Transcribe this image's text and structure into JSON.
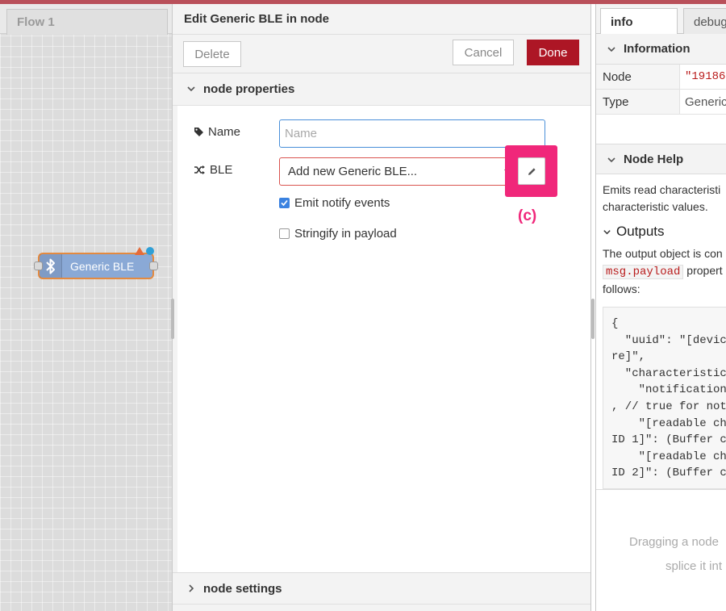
{
  "workspace": {
    "flow_tab": "Flow 1",
    "node_label": "Generic BLE"
  },
  "dialog": {
    "title": "Edit Generic BLE in node",
    "delete_label": "Delete",
    "cancel_label": "Cancel",
    "done_label": "Done",
    "sections": {
      "properties": "node properties",
      "settings": "node settings"
    },
    "name_label": "Name",
    "name_placeholder": "Name",
    "name_value": "",
    "ble_label": "BLE",
    "ble_selected": "Add new Generic BLE...",
    "emit_label": "Emit notify events",
    "emit_checked": true,
    "stringify_label": "Stringify in payload",
    "stringify_checked": false,
    "callout_label": "(c)"
  },
  "sidebar": {
    "tabs": [
      "info",
      "debug"
    ],
    "information_heading": "Information",
    "info_rows": [
      {
        "key": "Node",
        "value": "\"19186"
      },
      {
        "key": "Type",
        "value": "Generic"
      }
    ],
    "help_heading": "Node Help",
    "help_line1": "Emits read characteristi",
    "help_line2": "characteristic values.",
    "outputs_heading": "Outputs",
    "outputs_line1": "The output object is con",
    "outputs_code": "msg.payload",
    "outputs_line2_suffix": " propert",
    "outputs_line3": "follows:",
    "code_lines": "{\n  \"uuid\": \"[devic\nre]\",\n  \"characteristic\n    \"notification\n, // true for not\n    \"[readable ch\nID 1]\": (Buffer c\n    \"[readable ch\nID 2]\": (Buffer c",
    "drag_tip_line1": "Dragging a node",
    "drag_tip_line2": "splice it int"
  },
  "colors": {
    "accent_top": "#b9505a",
    "done_button": "#ad1625",
    "highlight": "#f0277a",
    "node_fill": "#8aa9d6",
    "node_border": "#e48a40"
  }
}
